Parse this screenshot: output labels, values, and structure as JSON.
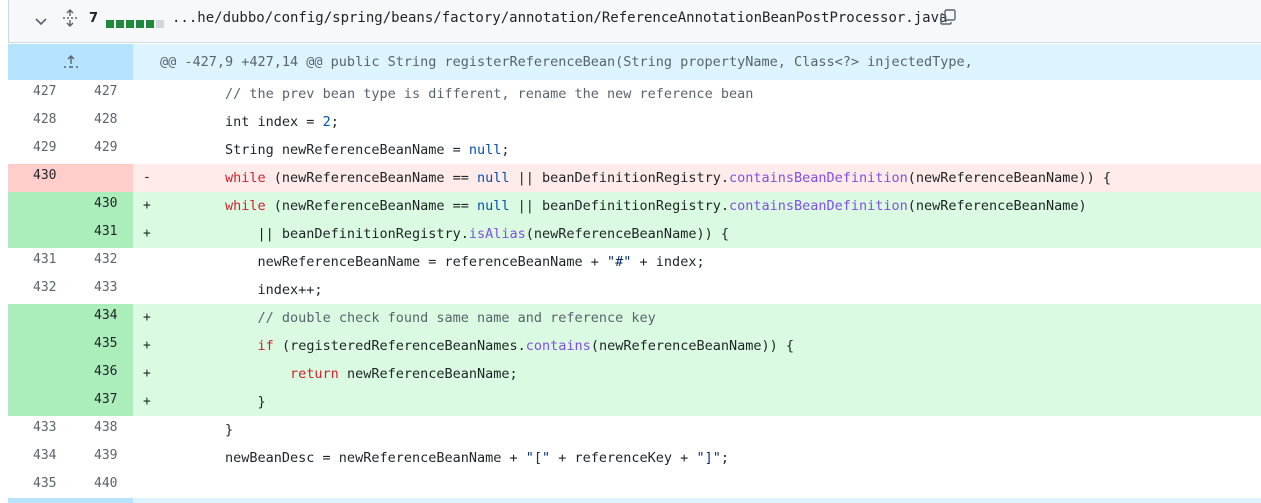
{
  "file": {
    "changes_count": "7",
    "path": "...he/dubbo/config/spring/beans/factory/annotation/ReferenceAnnotationBeanPostProcessor.java",
    "diffstat": [
      "add",
      "add",
      "add",
      "add",
      "add",
      "neutral"
    ]
  },
  "hunk": {
    "header": "@@ -427,9 +427,14 @@ public String registerReferenceBean(String propertyName, Class<?> injectedType,"
  },
  "colors": {
    "added_bg": "#dafbe1",
    "added_gutter": "#aceebb",
    "removed_bg": "#ffebe9",
    "removed_gutter": "#ffcecb",
    "hunk_bg": "#ddf4ff",
    "keyword": "#cf222e",
    "method": "#8250df"
  },
  "lines": [
    {
      "type": "ctx",
      "old": "427",
      "new": "427",
      "marker": "",
      "code": "        // the prev bean type is different, rename the new reference bean"
    },
    {
      "type": "ctx",
      "old": "428",
      "new": "428",
      "marker": "",
      "code": "        int index = 2;"
    },
    {
      "type": "ctx",
      "old": "429",
      "new": "429",
      "marker": "",
      "code": "        String newReferenceBeanName = null;"
    },
    {
      "type": "del",
      "old": "430",
      "new": "",
      "marker": "-",
      "code": "        while (newReferenceBeanName == null || beanDefinitionRegistry.containsBeanDefinition(newReferenceBeanName)) {"
    },
    {
      "type": "add",
      "old": "",
      "new": "430",
      "marker": "+",
      "code": "        while (newReferenceBeanName == null || beanDefinitionRegistry.containsBeanDefinition(newReferenceBeanName)"
    },
    {
      "type": "add",
      "old": "",
      "new": "431",
      "marker": "+",
      "code": "            || beanDefinitionRegistry.isAlias(newReferenceBeanName)) {"
    },
    {
      "type": "ctx",
      "old": "431",
      "new": "432",
      "marker": "",
      "code": "            newReferenceBeanName = referenceBeanName + \"#\" + index;"
    },
    {
      "type": "ctx",
      "old": "432",
      "new": "433",
      "marker": "",
      "code": "            index++;"
    },
    {
      "type": "add",
      "old": "",
      "new": "434",
      "marker": "+",
      "code": "            // double check found same name and reference key"
    },
    {
      "type": "add",
      "old": "",
      "new": "435",
      "marker": "+",
      "code": "            if (registeredReferenceBeanNames.contains(newReferenceBeanName)) {"
    },
    {
      "type": "add",
      "old": "",
      "new": "436",
      "marker": "+",
      "code": "                return newReferenceBeanName;"
    },
    {
      "type": "add",
      "old": "",
      "new": "437",
      "marker": "+",
      "code": "            }"
    },
    {
      "type": "ctx",
      "old": "433",
      "new": "438",
      "marker": "",
      "code": "        }"
    },
    {
      "type": "ctx",
      "old": "434",
      "new": "439",
      "marker": "",
      "code": "        newBeanDesc = newReferenceBeanName + \"[\" + referenceKey + \"]\";"
    },
    {
      "type": "ctx",
      "old": "435",
      "new": "440",
      "marker": "",
      "code": ""
    }
  ]
}
